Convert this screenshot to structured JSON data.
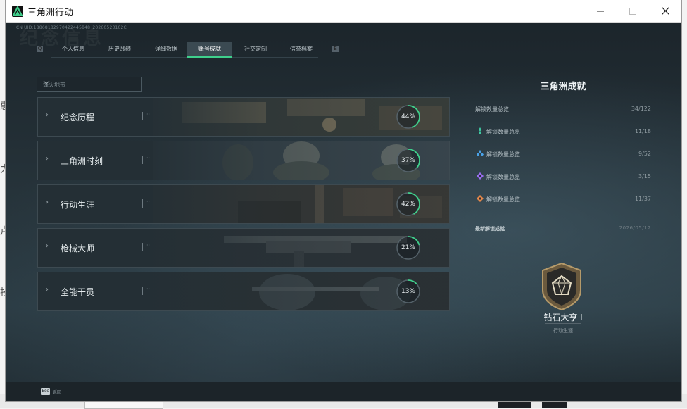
{
  "window": {
    "title": "三角洲行动"
  },
  "header": {
    "uid": "CN UID:18868182970422445848_20260523102C",
    "ghost_title": "纪念信息"
  },
  "tabs": [
    {
      "label": "个人信息"
    },
    {
      "label": "历史战绩"
    },
    {
      "label": "详细数据"
    },
    {
      "label": "账号成就"
    },
    {
      "label": "社交定制"
    },
    {
      "label": "信誉档案"
    }
  ],
  "tab_nav": {
    "prev": "Q",
    "next": "E"
  },
  "filter": {
    "value": "烽火地带"
  },
  "achievements": [
    {
      "name": "纪念历程",
      "percent": "44%",
      "progress": 0.44
    },
    {
      "name": "三角洲时刻",
      "percent": "37%",
      "progress": 0.37
    },
    {
      "name": "行动生涯",
      "percent": "42%",
      "progress": 0.42
    },
    {
      "name": "枪械大师",
      "percent": "21%",
      "progress": 0.21
    },
    {
      "name": "全能干员",
      "percent": "13%",
      "progress": 0.13
    }
  ],
  "side": {
    "title": "三角洲成就",
    "total": {
      "label": "解锁数量总览",
      "value": "34/122"
    },
    "categories": [
      {
        "label": "解锁数量总览",
        "value": "11/18",
        "icon": "green-diamond-icon",
        "color": "#3fc8a2"
      },
      {
        "label": "解锁数量总览",
        "value": "9/52",
        "icon": "blue-diamond-icon",
        "color": "#4aa3e8"
      },
      {
        "label": "解锁数量总览",
        "value": "3/15",
        "icon": "purple-diamond-icon",
        "color": "#9a6cf0"
      },
      {
        "label": "解锁数量总览",
        "value": "11/37",
        "icon": "orange-diamond-icon",
        "color": "#e8894a"
      }
    ],
    "latest": {
      "label": "最新解锁成就",
      "date": "2026/05/12"
    },
    "badge": {
      "name": "钻石大亨 I",
      "category": "行动生涯"
    }
  },
  "footer": {
    "esc_key": "Esc",
    "esc_label": "返回"
  },
  "accent": "#3fd08c"
}
